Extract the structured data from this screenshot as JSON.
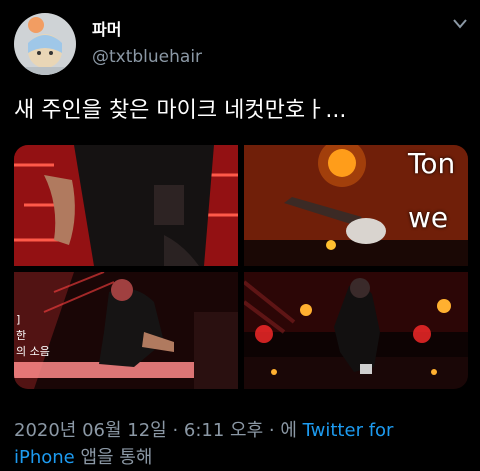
{
  "user": {
    "display_name": "파머",
    "handle": "@txtbluehair"
  },
  "tweet": {
    "text": "새 주인을 찾은 마이크 네컷만호ㅏ..."
  },
  "media": {
    "captions": {
      "ton": "Ton",
      "we": "we",
      "subtitle_line1": "]",
      "subtitle_line2": "한",
      "subtitle_line3": "의 소음"
    }
  },
  "meta": {
    "timestamp": "2020년 06월 12일 · 6:11 오후 · 에",
    "source_part1": "Twitter for",
    "source_part2": "iPhone",
    "suffix": "앱을 통해"
  },
  "icons": {
    "caret": "chevron-down-icon"
  },
  "colors": {
    "background": "#000000",
    "text": "#ffffff",
    "muted": "#8b98a5",
    "link": "#1d9bf0"
  }
}
